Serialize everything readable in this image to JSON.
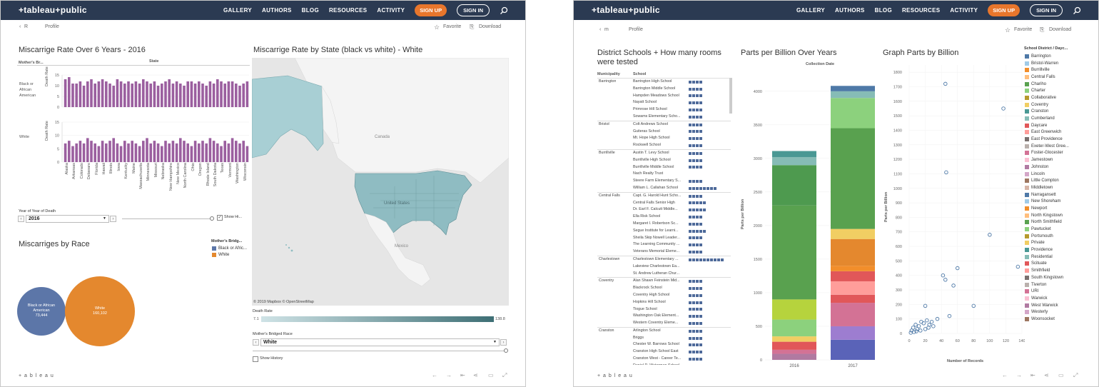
{
  "left": {
    "nav": {
      "logo": "+tableau+public",
      "links": [
        "GALLERY",
        "AUTHORS",
        "BLOG",
        "RESOURCES",
        "ACTIVITY"
      ],
      "signup": "SIGN UP",
      "signin": "SIGN IN"
    },
    "sub": {
      "back": "R",
      "profile": "Profile",
      "favorite": "Favorite",
      "download": "Download"
    },
    "bar_title": "Miscarrige Rate Over 6 Years - 2016",
    "bar_hdr_col": "Mother's Br...",
    "bar_hdr_state": "State",
    "row_black": "Black or African American",
    "row_white": "White",
    "ylabel": "Death Rate",
    "yticks": [
      "15",
      "10",
      "5",
      "0"
    ],
    "states": [
      "Alaska",
      "Arkansas",
      "Colorado",
      "Delaware",
      "Florida",
      "Hawaii",
      "Illinois",
      "Iowa",
      "Kentucky",
      "Maine",
      "Massachusetts",
      "Minnesota",
      "Missouri",
      "Nebraska",
      "New Hampshire",
      "New Mexico",
      "North Carolina",
      "Ohio",
      "Oregon",
      "Rhode Island",
      "South Dakota",
      "Texas",
      "Vermont",
      "Washington",
      "Wisconsin"
    ],
    "black_values": [
      13,
      14,
      11,
      11,
      12,
      10,
      12,
      13,
      11,
      12,
      13,
      12,
      11,
      10,
      13,
      12,
      11,
      12,
      11,
      12,
      11,
      13,
      12,
      11,
      12,
      10,
      11,
      12,
      13,
      11,
      12,
      11,
      10,
      12,
      12,
      11,
      12,
      11,
      10,
      12,
      11,
      13,
      12,
      11,
      12,
      12,
      11,
      10,
      11,
      12
    ],
    "white_values": [
      7,
      8,
      6,
      7,
      8,
      7,
      9,
      8,
      7,
      6,
      8,
      7,
      8,
      9,
      7,
      6,
      8,
      7,
      8,
      7,
      6,
      8,
      9,
      7,
      8,
      7,
      6,
      8,
      7,
      8,
      7,
      9,
      8,
      7,
      6,
      8,
      7,
      8,
      7,
      9,
      8,
      7,
      6,
      8,
      7,
      9,
      8,
      7,
      8,
      6
    ],
    "filter_label": "Year of Year of Death",
    "filter_value": "2016",
    "show_history": "Show Hi...",
    "map_title": "Miscarrige Rate by State (black vs white) - White",
    "map_labels": {
      "canada": "Canada",
      "us": "United States",
      "mexico": "Mexico"
    },
    "map_credit": "© 2019 Mapbox © OpenStreetMap",
    "death_rate_label": "Death Rate",
    "death_rate_min": "7.1",
    "death_rate_max": "138.8",
    "race_label": "Mother's Bridged Race",
    "race_value": "White",
    "show_history2": "Show History",
    "pie_title": "Miscarriges by Race",
    "legend_title": "Mother's Bridg...",
    "legend": [
      {
        "label": "Black or Afric...",
        "color": "#5c76a8"
      },
      {
        "label": "White",
        "color": "#e4882e"
      }
    ],
    "bubble_black": {
      "label": "Black or African American",
      "value": "73,444"
    },
    "bubble_white": {
      "label": "White",
      "value": "160,102"
    },
    "footer_logo": "+ a b l e a u"
  },
  "right": {
    "nav": {
      "logo": "+tableau+public",
      "links": [
        "GALLERY",
        "AUTHORS",
        "BLOG",
        "RESOURCES",
        "ACTIVITY"
      ],
      "signup": "SIGN UP",
      "signin": "SIGN IN"
    },
    "sub": {
      "back": "m",
      "profile": "Profile",
      "favorite": "Favorite",
      "download": "Download"
    },
    "tbl_title": "District Schools + How many rooms were tested",
    "col_muni": "Municipality",
    "col_school": "School",
    "groups": [
      {
        "muni": "Barrington",
        "schools": [
          {
            "n": "Barrington High School",
            "d": 4
          },
          {
            "n": "Barrington Middle School",
            "d": 4
          },
          {
            "n": "Hampden Meadows School",
            "d": 4
          },
          {
            "n": "Nayatt School",
            "d": 4
          },
          {
            "n": "Primrose Hill School",
            "d": 4
          },
          {
            "n": "Sowams Elementary Scho...",
            "d": 4
          }
        ]
      },
      {
        "muni": "Bristol",
        "schools": [
          {
            "n": "Colt Andrews School",
            "d": 4
          },
          {
            "n": "Guiteras School",
            "d": 4
          },
          {
            "n": "Mt. Hope High School",
            "d": 4
          },
          {
            "n": "Rockwell School",
            "d": 4
          }
        ]
      },
      {
        "muni": "Burrillville",
        "schools": [
          {
            "n": "Austin T. Levy School",
            "d": 4
          },
          {
            "n": "Burrillville High School",
            "d": 4
          },
          {
            "n": "Burrillville Middle School",
            "d": 4
          },
          {
            "n": "Nach Realty Trust",
            "d": 0
          },
          {
            "n": "Steere Farm Elementary S...",
            "d": 4
          },
          {
            "n": "William L. Callahan School",
            "d": 8
          }
        ]
      },
      {
        "muni": "Central Falls",
        "schools": [
          {
            "n": "Capt. G. Harold Hunt Scho...",
            "d": 4
          },
          {
            "n": "Central Falls Senior High",
            "d": 5
          },
          {
            "n": "Dr. Earl F. Calcutt Middle...",
            "d": 5
          },
          {
            "n": "Ella Risk School",
            "d": 4
          },
          {
            "n": "Margaret I. Robertson Sc...",
            "d": 4
          },
          {
            "n": "Segue Institute for Learni...",
            "d": 5
          },
          {
            "n": "Sheila Skip Nowell Leader...",
            "d": 4
          },
          {
            "n": "The Learning Community ...",
            "d": 4
          },
          {
            "n": "Veterans Memorial Eleme...",
            "d": 4
          }
        ]
      },
      {
        "muni": "Charlestown",
        "schools": [
          {
            "n": "Charlestown Elementary ...",
            "d": 10
          },
          {
            "n": "Lakeview Charlestown Ea...",
            "d": 0
          },
          {
            "n": "St. Andrew Lutheran Chur...",
            "d": 0
          }
        ]
      },
      {
        "muni": "Coventry",
        "schools": [
          {
            "n": "Alan Shawn Feinstein Mid...",
            "d": 4
          },
          {
            "n": "Blackrock School",
            "d": 4
          },
          {
            "n": "Coventry High School",
            "d": 4
          },
          {
            "n": "Hopkins Hill School",
            "d": 4
          },
          {
            "n": "Tiogue School",
            "d": 4
          },
          {
            "n": "Washington Oak Element...",
            "d": 4
          },
          {
            "n": "Western Coventry Eleme...",
            "d": 4
          }
        ]
      },
      {
        "muni": "Cranston",
        "schools": [
          {
            "n": "Arlington School",
            "d": 4
          },
          {
            "n": "Briggs",
            "d": 4
          },
          {
            "n": "Chester W. Barrows School",
            "d": 4
          },
          {
            "n": "Cranston High School East",
            "d": 4
          },
          {
            "n": "Cranston West - Career Te...",
            "d": 4
          },
          {
            "n": "Daniel D. Waterman School",
            "d": 4
          }
        ]
      }
    ],
    "ppb_title": "Parts per Billion Over Years",
    "ppb_sub": "Collection Date",
    "ppb_ylabel": "Parts per Billion",
    "ppb_yticks": [
      "4000",
      "3500",
      "3000",
      "2500",
      "2000",
      "1500",
      "1000",
      "500",
      "0"
    ],
    "ppb_years": [
      "2016",
      "2017"
    ],
    "sc_title": "Graph Parts by Billion",
    "sc_ylabel": "Parts per Billion",
    "sc_xlabel": "Number of Records",
    "sc_yticks": [
      "1800",
      "1700",
      "1600",
      "1500",
      "1400",
      "1300",
      "1200",
      "1100",
      "1000",
      "900",
      "800",
      "700",
      "600",
      "500",
      "400",
      "300",
      "200",
      "100",
      "0"
    ],
    "sc_xticks": [
      "0",
      "20",
      "40",
      "60",
      "80",
      "100",
      "120",
      "140"
    ],
    "legend_title": "School District / Dayc...",
    "legend": [
      {
        "label": "Barrington",
        "color": "#4e79a7"
      },
      {
        "label": "Bristol-Warren",
        "color": "#a0cbe8"
      },
      {
        "label": "Burrillville",
        "color": "#f28e2b"
      },
      {
        "label": "Central Falls",
        "color": "#ffbe7d"
      },
      {
        "label": "Chariho",
        "color": "#59a14f"
      },
      {
        "label": "Charter",
        "color": "#8cd17d"
      },
      {
        "label": "Collaborative",
        "color": "#b6992d"
      },
      {
        "label": "Coventry",
        "color": "#f1ce63"
      },
      {
        "label": "Cranston",
        "color": "#499894"
      },
      {
        "label": "Cumberland",
        "color": "#86bcb6"
      },
      {
        "label": "Daycare",
        "color": "#e15759"
      },
      {
        "label": "East Greenwich",
        "color": "#ff9d9a"
      },
      {
        "label": "East Providence",
        "color": "#79706e"
      },
      {
        "label": "Exeter-West Gree...",
        "color": "#bab0ac"
      },
      {
        "label": "Foster-Glocester",
        "color": "#d37295"
      },
      {
        "label": "Jamestown",
        "color": "#fabfd2"
      },
      {
        "label": "Johnston",
        "color": "#b07aa1"
      },
      {
        "label": "Lincoln",
        "color": "#d4a6c8"
      },
      {
        "label": "Little Compton",
        "color": "#9d7660"
      },
      {
        "label": "Middletown",
        "color": "#d7b5a6"
      },
      {
        "label": "Narragansett",
        "color": "#4e79a7"
      },
      {
        "label": "New Shoreham",
        "color": "#a0cbe8"
      },
      {
        "label": "Newport",
        "color": "#f28e2b"
      },
      {
        "label": "North Kingstown",
        "color": "#ffbe7d"
      },
      {
        "label": "North Smithfield",
        "color": "#59a14f"
      },
      {
        "label": "Pawtucket",
        "color": "#8cd17d"
      },
      {
        "label": "Portsmouth",
        "color": "#b6992d"
      },
      {
        "label": "Private",
        "color": "#f1ce63"
      },
      {
        "label": "Providence",
        "color": "#499894"
      },
      {
        "label": "Residential",
        "color": "#86bcb6"
      },
      {
        "label": "Scituate",
        "color": "#e15759"
      },
      {
        "label": "Smithfield",
        "color": "#ff9d9a"
      },
      {
        "label": "South Kingstown",
        "color": "#79706e"
      },
      {
        "label": "Tiverton",
        "color": "#bab0ac"
      },
      {
        "label": "URI",
        "color": "#d37295"
      },
      {
        "label": "Warwick",
        "color": "#fabfd2"
      },
      {
        "label": "West Warwick",
        "color": "#b07aa1"
      },
      {
        "label": "Westerly",
        "color": "#d4a6c8"
      },
      {
        "label": "Woonsocket",
        "color": "#9d7660"
      }
    ],
    "footer_logo": "+ a b l e a u"
  },
  "chart_data": [
    {
      "type": "bar",
      "title": "Parts per Billion Over Years",
      "xlabel": "Collection Date",
      "ylabel": "Parts per Billion",
      "categories": [
        "2016",
        "2017"
      ],
      "values": [
        3110,
        4080
      ],
      "ylim": [
        0,
        4200
      ]
    },
    {
      "type": "scatter",
      "title": "Graph Parts by Billion",
      "xlabel": "Number of Records",
      "ylabel": "Parts per Billion",
      "xlim": [
        0,
        140
      ],
      "ylim": [
        0,
        1850
      ],
      "points": [
        [
          45,
          1720
        ],
        [
          117,
          1550
        ],
        [
          46,
          1110
        ],
        [
          100,
          680
        ],
        [
          60,
          450
        ],
        [
          135,
          460
        ],
        [
          42,
          400
        ],
        [
          45,
          370
        ],
        [
          55,
          330
        ],
        [
          80,
          190
        ],
        [
          20,
          190
        ],
        [
          50,
          120
        ],
        [
          35,
          100
        ],
        [
          8,
          60
        ],
        [
          12,
          50
        ],
        [
          15,
          80
        ],
        [
          18,
          70
        ],
        [
          22,
          90
        ],
        [
          25,
          60
        ],
        [
          28,
          80
        ],
        [
          30,
          50
        ],
        [
          5,
          40
        ],
        [
          3,
          20
        ],
        [
          10,
          30
        ],
        [
          6,
          10
        ],
        [
          14,
          20
        ],
        [
          20,
          30
        ],
        [
          24,
          40
        ],
        [
          2,
          5
        ],
        [
          9,
          15
        ]
      ]
    }
  ]
}
